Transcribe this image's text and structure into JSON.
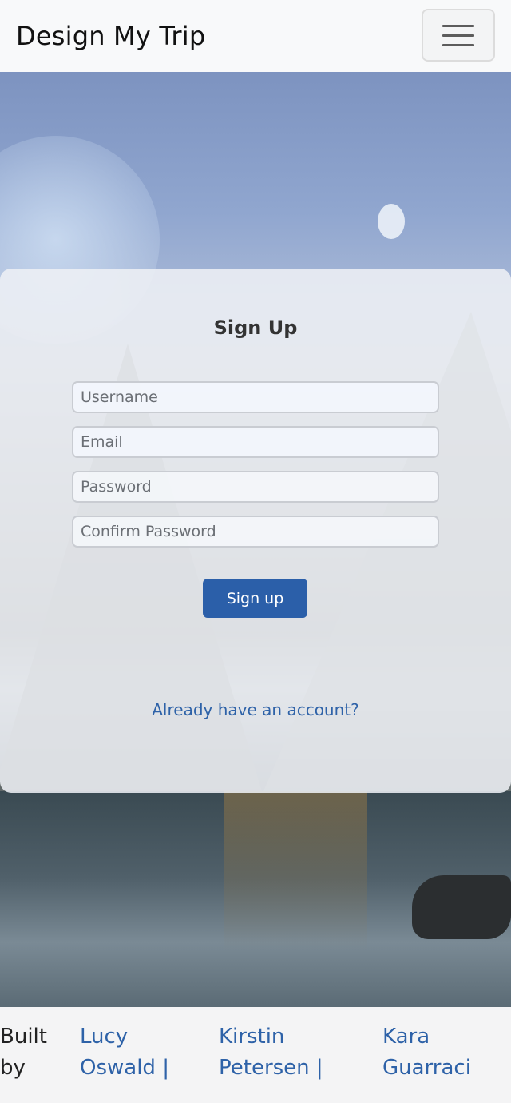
{
  "navbar": {
    "brand": "Design My Trip",
    "toggle_icon": "hamburger-menu-icon"
  },
  "signup": {
    "title": "Sign Up",
    "username_placeholder": "Username",
    "email_placeholder": "Email",
    "password_placeholder": "Password",
    "confirm_placeholder": "Confirm Password",
    "submit_label": "Sign up",
    "login_link": "Already have an account?"
  },
  "footer": {
    "built_by": "Built by",
    "authors": [
      "Lucy Oswald |",
      "Kirstin Petersen |",
      "Kara Guarraci"
    ]
  },
  "colors": {
    "accent": "#2b5fa9",
    "link": "#2e62a8",
    "navbar_bg": "#f8f9fa"
  }
}
